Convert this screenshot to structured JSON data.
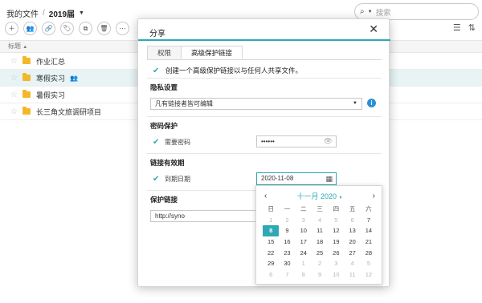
{
  "breadcrumb": {
    "root": "我的文件",
    "sep": "/",
    "current": "2019届"
  },
  "search": {
    "placeholder": "搜索"
  },
  "column_header": {
    "title": "标题"
  },
  "files": [
    {
      "name": "作业汇总",
      "selected": false,
      "shared": false
    },
    {
      "name": "寒假实习",
      "selected": true,
      "shared": true
    },
    {
      "name": "暑假实习",
      "selected": false,
      "shared": false
    },
    {
      "name": "长三角文旅调研项目",
      "selected": false,
      "shared": false
    }
  ],
  "dialog": {
    "title": "分享",
    "tabs": [
      "权限",
      "高级保护链接"
    ],
    "create_link_label": "创建一个高级保护链接以与任何人共享文件。",
    "privacy_title": "隐私设置",
    "privacy_value": "凡有链接者皆可编辑",
    "password_title": "密码保护",
    "password_label": "需要密码",
    "password_value": "••••••",
    "expiry_title": "链接有效期",
    "expiry_label": "到期日期",
    "expiry_value": "2020-11-08",
    "link_title": "保护链接",
    "link_value": "http://syno"
  },
  "calendar": {
    "month_label": "十一月 2020",
    "weekdays": [
      "日",
      "一",
      "二",
      "三",
      "四",
      "五",
      "六"
    ],
    "days": [
      [
        "1",
        "2",
        "3",
        "4",
        "5",
        "6",
        "7"
      ],
      [
        "8",
        "9",
        "10",
        "11",
        "12",
        "13",
        "14"
      ],
      [
        "15",
        "16",
        "17",
        "18",
        "19",
        "20",
        "21"
      ],
      [
        "22",
        "23",
        "24",
        "25",
        "26",
        "27",
        "28"
      ],
      [
        "29",
        "30",
        "1",
        "2",
        "3",
        "4",
        "5"
      ],
      [
        "6",
        "7",
        "8",
        "9",
        "10",
        "11",
        "12"
      ]
    ],
    "selected": "8",
    "accent": "#2fa8b6"
  }
}
